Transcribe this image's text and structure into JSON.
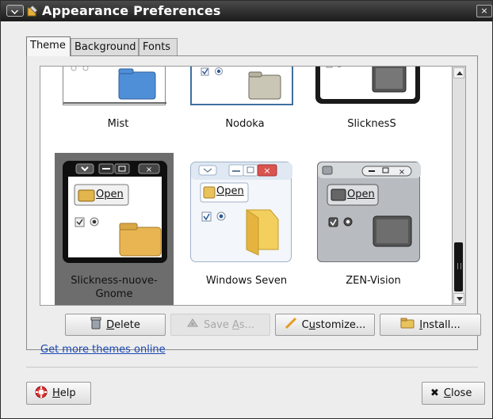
{
  "window": {
    "title": "Appearance Preferences"
  },
  "tabs": [
    {
      "label": "Theme",
      "active": true
    },
    {
      "label": "Background",
      "active": false
    },
    {
      "label": "Fonts",
      "active": false
    }
  ],
  "themes": [
    {
      "name": "Mist"
    },
    {
      "name": "Nodoka"
    },
    {
      "name": "SlicknesS"
    },
    {
      "name": "Slickness-nuove-Gnome",
      "selected": true
    },
    {
      "name": "Windows Seven"
    },
    {
      "name": "ZEN-Vision"
    }
  ],
  "preview": {
    "open_label": "Open"
  },
  "actions": {
    "delete": {
      "prefix": "",
      "u": "D",
      "rest": "elete"
    },
    "save_as": {
      "prefix": "Save ",
      "u": "A",
      "rest": "s..."
    },
    "customize": {
      "prefix": "C",
      "u": "u",
      "rest": "stomize..."
    },
    "install": {
      "prefix": "",
      "u": "I",
      "rest": "nstall..."
    }
  },
  "more_themes_link": "Get more themes online",
  "footer": {
    "help": {
      "u": "H",
      "rest": "elp"
    },
    "close": {
      "u": "C",
      "rest": "lose"
    }
  },
  "colors": {
    "selection_bg": "#6d6d6d",
    "link": "#1a47b5",
    "titlebar": "#1b1b1b"
  }
}
